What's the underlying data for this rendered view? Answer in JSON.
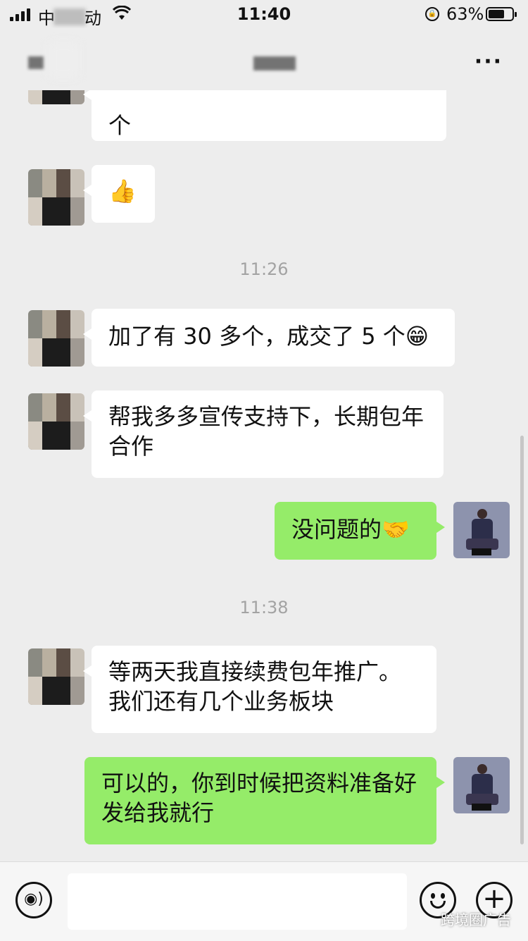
{
  "status_bar": {
    "carrier": "中",
    "network_suffix": "动",
    "time": "11:40",
    "battery_percent": "63%",
    "battery_level": 0.63
  },
  "nav": {
    "more_label": "···"
  },
  "messages": [
    {
      "direction": "in",
      "text": "个"
    },
    {
      "direction": "in",
      "text": "👍"
    },
    {
      "direction": "in",
      "text": "加了有 30 多个，成交了 5 个😁"
    },
    {
      "direction": "in",
      "text": "帮我多多宣传支持下，长期包年合作"
    },
    {
      "direction": "out",
      "text": "没问题的🤝"
    },
    {
      "direction": "in",
      "text": "等两天我直接续费包年推广。我们还有几个业务板块"
    },
    {
      "direction": "out",
      "text": "可以的，你到时候把资料准备好发给我就行"
    }
  ],
  "timestamps": [
    "11:26",
    "11:38"
  ],
  "input_bar": {
    "placeholder": "",
    "plus_label": "+",
    "voice_label": "◉)"
  },
  "watermark": "跨境圈广告",
  "colors": {
    "background": "#ededed",
    "incoming_bubble": "#ffffff",
    "outgoing_bubble": "#95ec69",
    "timestamp": "#a3a3a3"
  }
}
